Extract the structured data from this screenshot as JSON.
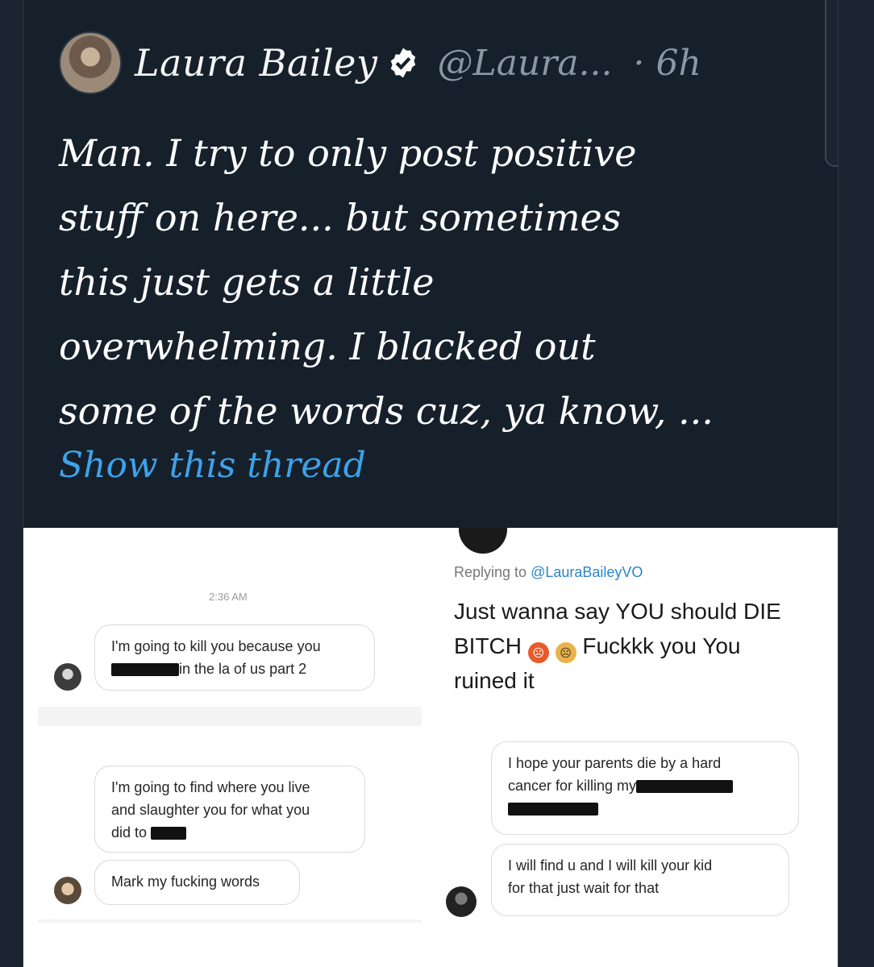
{
  "tweet": {
    "author_name": "Laura Bailey",
    "handle": "@Laura...",
    "time": "· 6h",
    "text_lines": [
      "Man. I try to only post positive",
      "stuff on here... but sometimes",
      "this just gets a little",
      "overwhelming. I blacked out",
      "some of the words cuz, ya know, ..."
    ],
    "show_thread": "Show this thread"
  },
  "screenshot_left": {
    "timestamp": "2:36 AM",
    "messages": [
      {
        "lines": [
          "I'm going to kill you because you",
          "in the la of us part 2"
        ]
      },
      {
        "lines": [
          "I'm going to find where you live",
          "and slaughter you for what you",
          "did to"
        ]
      },
      {
        "lines": [
          "Mark my fucking words"
        ]
      }
    ]
  },
  "screenshot_right": {
    "replying_prefix": "Replying to",
    "replying_mention": "@LauraBaileyVO",
    "reply_lines": [
      "Just wanna say YOU should DIE",
      "BITCH",
      "Fuckkk you You",
      "ruined it"
    ],
    "messages": [
      {
        "lines": [
          "I hope your parents die by a hard",
          "cancer for killing my"
        ]
      },
      {
        "lines": [
          "I will find u and I will kill your kid",
          "for that just wait for that"
        ]
      }
    ]
  },
  "colors": {
    "background": "#15202b",
    "link": "#3ea2e8",
    "muted": "#8a98a6",
    "verified": "#ffffff"
  }
}
